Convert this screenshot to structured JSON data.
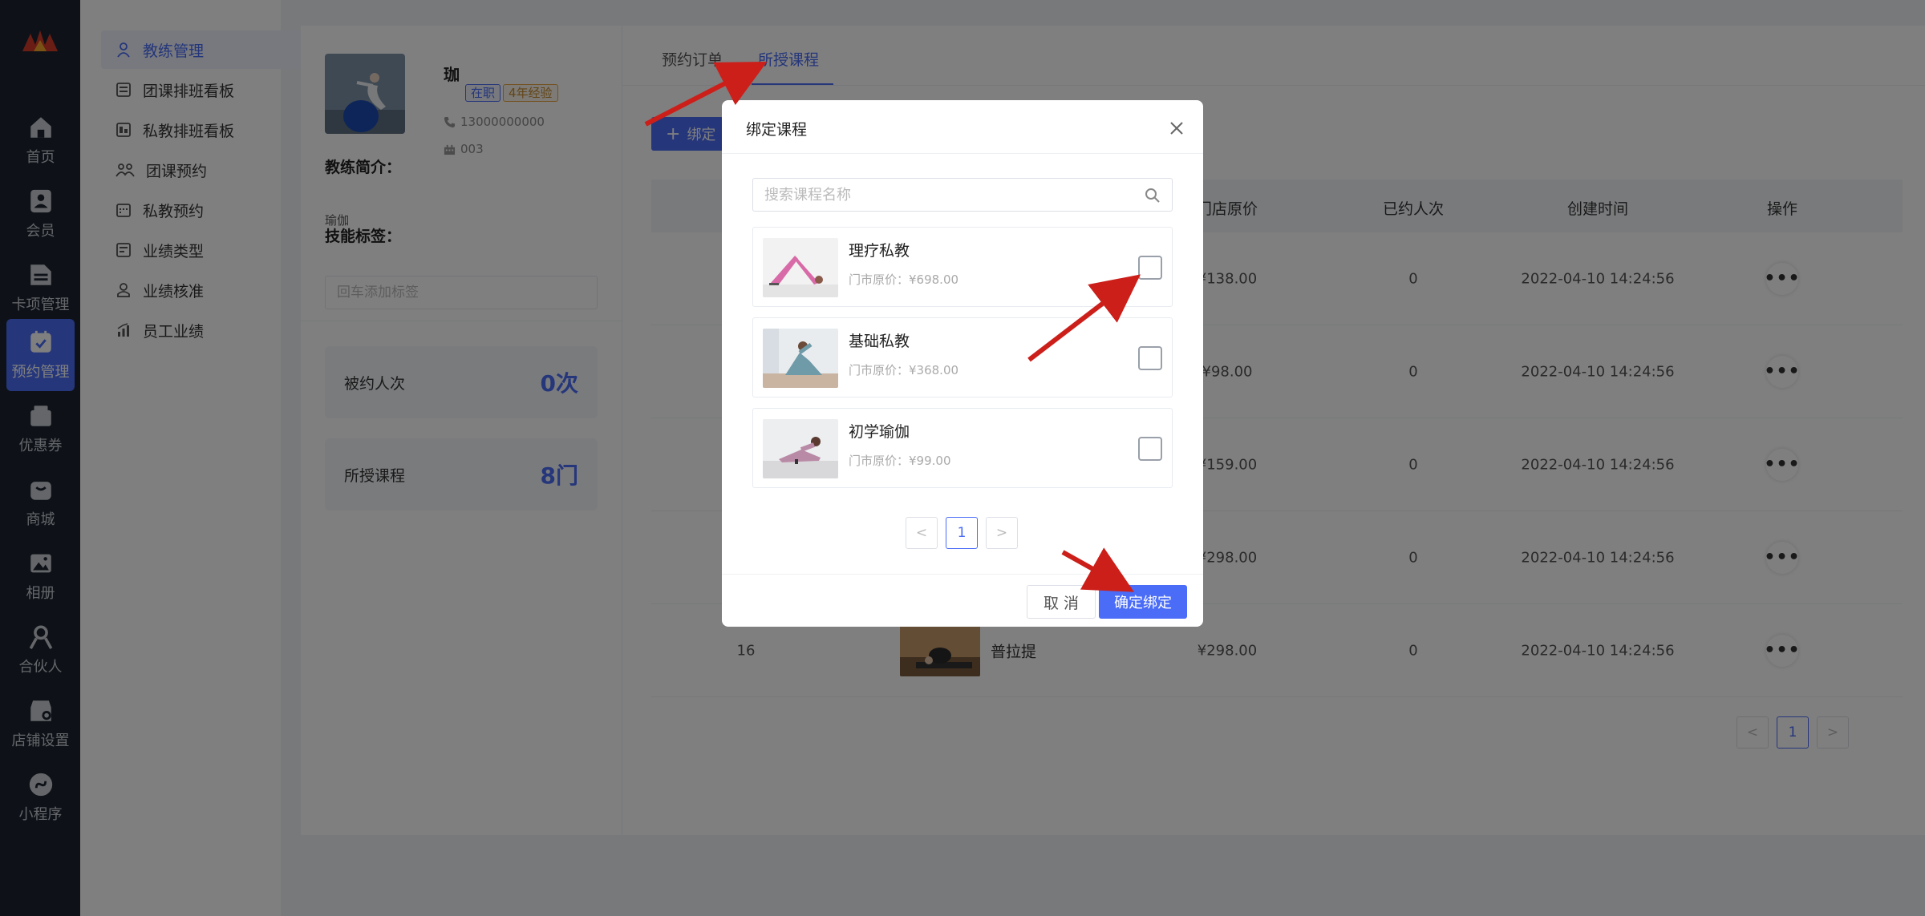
{
  "colors": {
    "accent": "#4a6cf7",
    "rail_bg": "#1d2530",
    "annotation": "#cc1f1a"
  },
  "rail": {
    "items": [
      {
        "label": "首页",
        "icon": "home-icon"
      },
      {
        "label": "会员",
        "icon": "member-icon"
      },
      {
        "label": "卡项管理",
        "icon": "card-icon"
      },
      {
        "label": "预约管理",
        "icon": "calendar-icon"
      },
      {
        "label": "优惠券",
        "icon": "coupon-icon"
      },
      {
        "label": "商城",
        "icon": "shop-bag-icon"
      },
      {
        "label": "相册",
        "icon": "album-icon"
      },
      {
        "label": "合伙人",
        "icon": "partner-icon"
      },
      {
        "label": "店铺设置",
        "icon": "store-icon"
      },
      {
        "label": "小程序",
        "icon": "mini-program-icon"
      }
    ]
  },
  "submenu": {
    "items": [
      {
        "label": "教练管理",
        "icon": "user-icon"
      },
      {
        "label": "团课排班看板",
        "icon": "board-icon"
      },
      {
        "label": "私教排班看板",
        "icon": "board-icon"
      },
      {
        "label": "团课预约",
        "icon": "group-icon"
      },
      {
        "label": "私教预约",
        "icon": "calendar-small-icon"
      },
      {
        "label": "业绩类型",
        "icon": "list-icon"
      },
      {
        "label": "业绩核准",
        "icon": "user-check-icon"
      },
      {
        "label": "员工业绩",
        "icon": "bar-chart-icon"
      }
    ]
  },
  "profile": {
    "name": "珈",
    "status": "在职",
    "experience": "4年经验",
    "phone": "13000000000",
    "code": "003",
    "intro_title": "教练简介：",
    "intro": "瑜伽",
    "skills_title": "技能标签：",
    "skills_placeholder": "回车添加标签"
  },
  "stats": [
    {
      "label": "被约人次",
      "value": "0次"
    },
    {
      "label": "所授课程",
      "value": "8门"
    }
  ],
  "tabs": [
    {
      "label": "预约订单"
    },
    {
      "label": "所授课程"
    }
  ],
  "bind_button": {
    "label": "绑定"
  },
  "table": {
    "headers": [
      "门店原价",
      "已约人次",
      "创建时间",
      "操作"
    ],
    "rows": [
      {
        "id": "",
        "name": "",
        "price": "¥138.00",
        "booked": "0",
        "created": "2022-04-10 14:24:56"
      },
      {
        "id": "",
        "name": "",
        "price": "¥98.00",
        "booked": "0",
        "created": "2022-04-10 14:24:56"
      },
      {
        "id": "",
        "name": "",
        "price": "¥159.00",
        "booked": "0",
        "created": "2022-04-10 14:24:56"
      },
      {
        "id": "",
        "name": "",
        "price": "¥298.00",
        "booked": "0",
        "created": "2022-04-10 14:24:56"
      },
      {
        "id": "16",
        "name": "普拉提",
        "price": "¥298.00",
        "booked": "0",
        "created": "2022-04-10 14:24:56"
      }
    ],
    "more_label": "•••",
    "pager": {
      "prev": "<",
      "current": "1",
      "next": ">"
    }
  },
  "modal": {
    "title": "绑定课程",
    "search_placeholder": "搜索课程名称",
    "courses": [
      {
        "name": "理疗私教",
        "price": "门市原价：¥698.00"
      },
      {
        "name": "基础私教",
        "price": "门市原价：¥368.00"
      },
      {
        "name": "初学瑜伽",
        "price": "门市原价：¥99.00"
      }
    ],
    "pager": {
      "prev": "<",
      "current": "1",
      "next": ">"
    },
    "cancel_label": "取 消",
    "confirm_label": "确定绑定"
  }
}
